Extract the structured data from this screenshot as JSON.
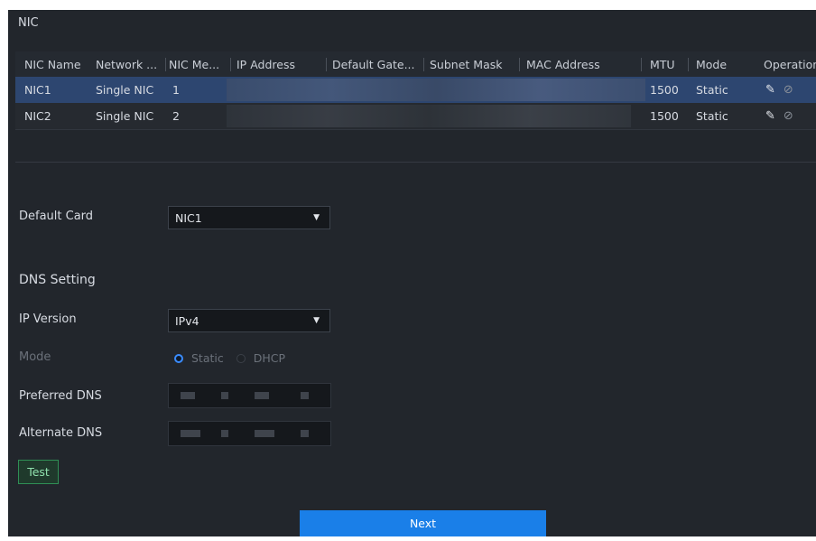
{
  "page": {
    "title": "NIC"
  },
  "table": {
    "columns": [
      "NIC Name",
      "Network ...",
      "NIC Me...",
      "IP Address",
      "Default Gate...",
      "Subnet Mask",
      "MAC Address",
      "MTU",
      "Mode",
      "Operation"
    ],
    "rows": [
      {
        "name": "NIC1",
        "network": "Single NIC",
        "member": "1",
        "mtu": "1500",
        "mode": "Static",
        "selected": true
      },
      {
        "name": "NIC2",
        "network": "Single NIC",
        "member": "2",
        "mtu": "1500",
        "mode": "Static",
        "selected": false
      }
    ]
  },
  "form": {
    "default_card_label": "Default Card",
    "default_card_value": "NIC1",
    "dns_section_title": "DNS Setting",
    "ip_version_label": "IP Version",
    "ip_version_value": "IPv4",
    "mode_label": "Mode",
    "mode_options": [
      "Static",
      "DHCP"
    ],
    "mode_selected": "Static",
    "preferred_dns_label": "Preferred DNS",
    "alternate_dns_label": "Alternate DNS",
    "test_label": "Test"
  },
  "footer": {
    "next_label": "Next"
  },
  "icons": {
    "dropdown": "dropdown-arrow-icon",
    "edit": "edit-pencil-icon",
    "unbind": "unlink-icon"
  },
  "colors": {
    "accent": "#1a7fe8",
    "selected_row": "#2d4670",
    "test_border": "#2f8f55",
    "background": "#22262c"
  }
}
